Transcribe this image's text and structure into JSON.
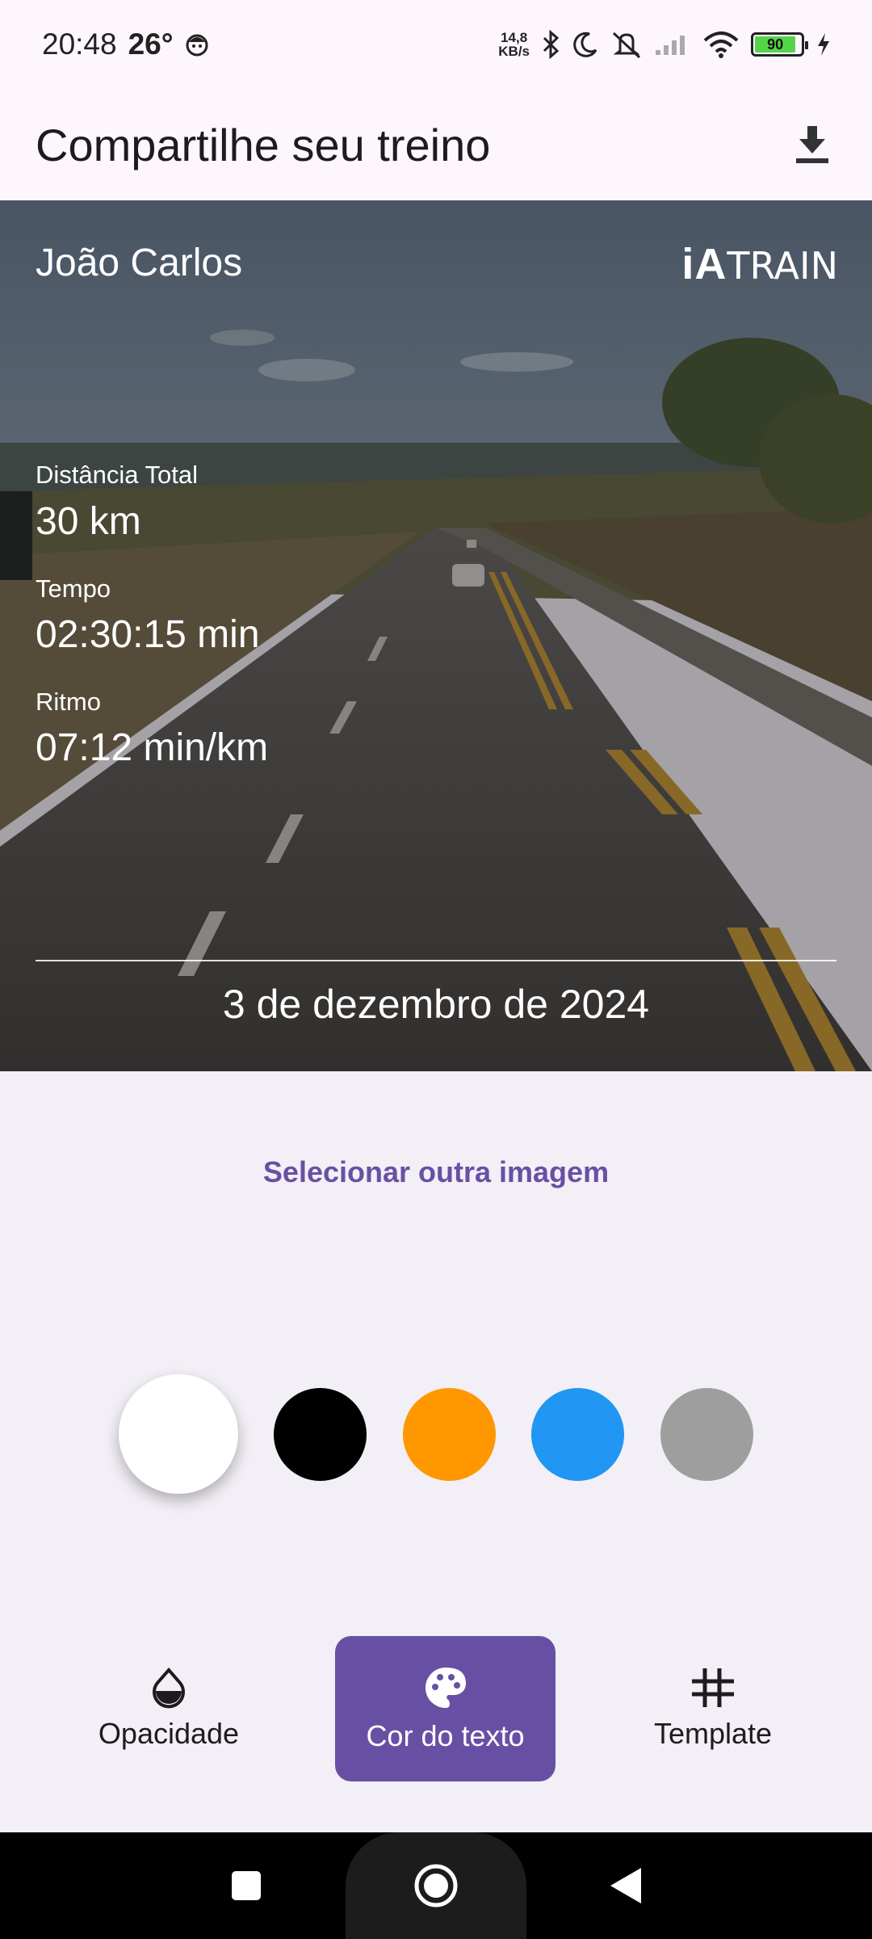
{
  "status_bar": {
    "time": "20:48",
    "temperature": "26°",
    "net_speed_value": "14,8",
    "net_speed_unit": "KB/s",
    "battery_level": "90",
    "icons": [
      "face-icon",
      "bluetooth-icon",
      "moon-icon",
      "silent-icon",
      "signal-icon",
      "wifi-icon",
      "battery-icon",
      "charging-icon"
    ]
  },
  "app_bar": {
    "title": "Compartilhe seu treino",
    "action_icon": "download-icon"
  },
  "preview": {
    "athlete_name": "João Carlos",
    "logo": {
      "ia": "iA",
      "train": "TRAIN"
    },
    "stats": [
      {
        "label": "Distância Total",
        "value": "30 km"
      },
      {
        "label": "Tempo",
        "value": "02:30:15 min"
      },
      {
        "label": "Ritmo",
        "value": "07:12 min/km"
      }
    ],
    "date": "3 de dezembro de 2024",
    "text_color": "#ffffff"
  },
  "select_image_label": "Selecionar outra imagem",
  "colors": {
    "accent": "#6750a4",
    "swatches": [
      "#ffffff",
      "#000000",
      "#ff9800",
      "#2196f3",
      "#9e9e9e"
    ],
    "selected_swatch": "#ffffff"
  },
  "toolbar": {
    "items": [
      {
        "label": "Opacidade",
        "icon": "opacity-icon",
        "active": false
      },
      {
        "label": "Cor do texto",
        "icon": "palette-icon",
        "active": true
      },
      {
        "label": "Template",
        "icon": "grid-icon",
        "active": false
      }
    ]
  },
  "nav_bar": {
    "icons": [
      "recents-icon",
      "home-icon",
      "back-icon"
    ]
  }
}
